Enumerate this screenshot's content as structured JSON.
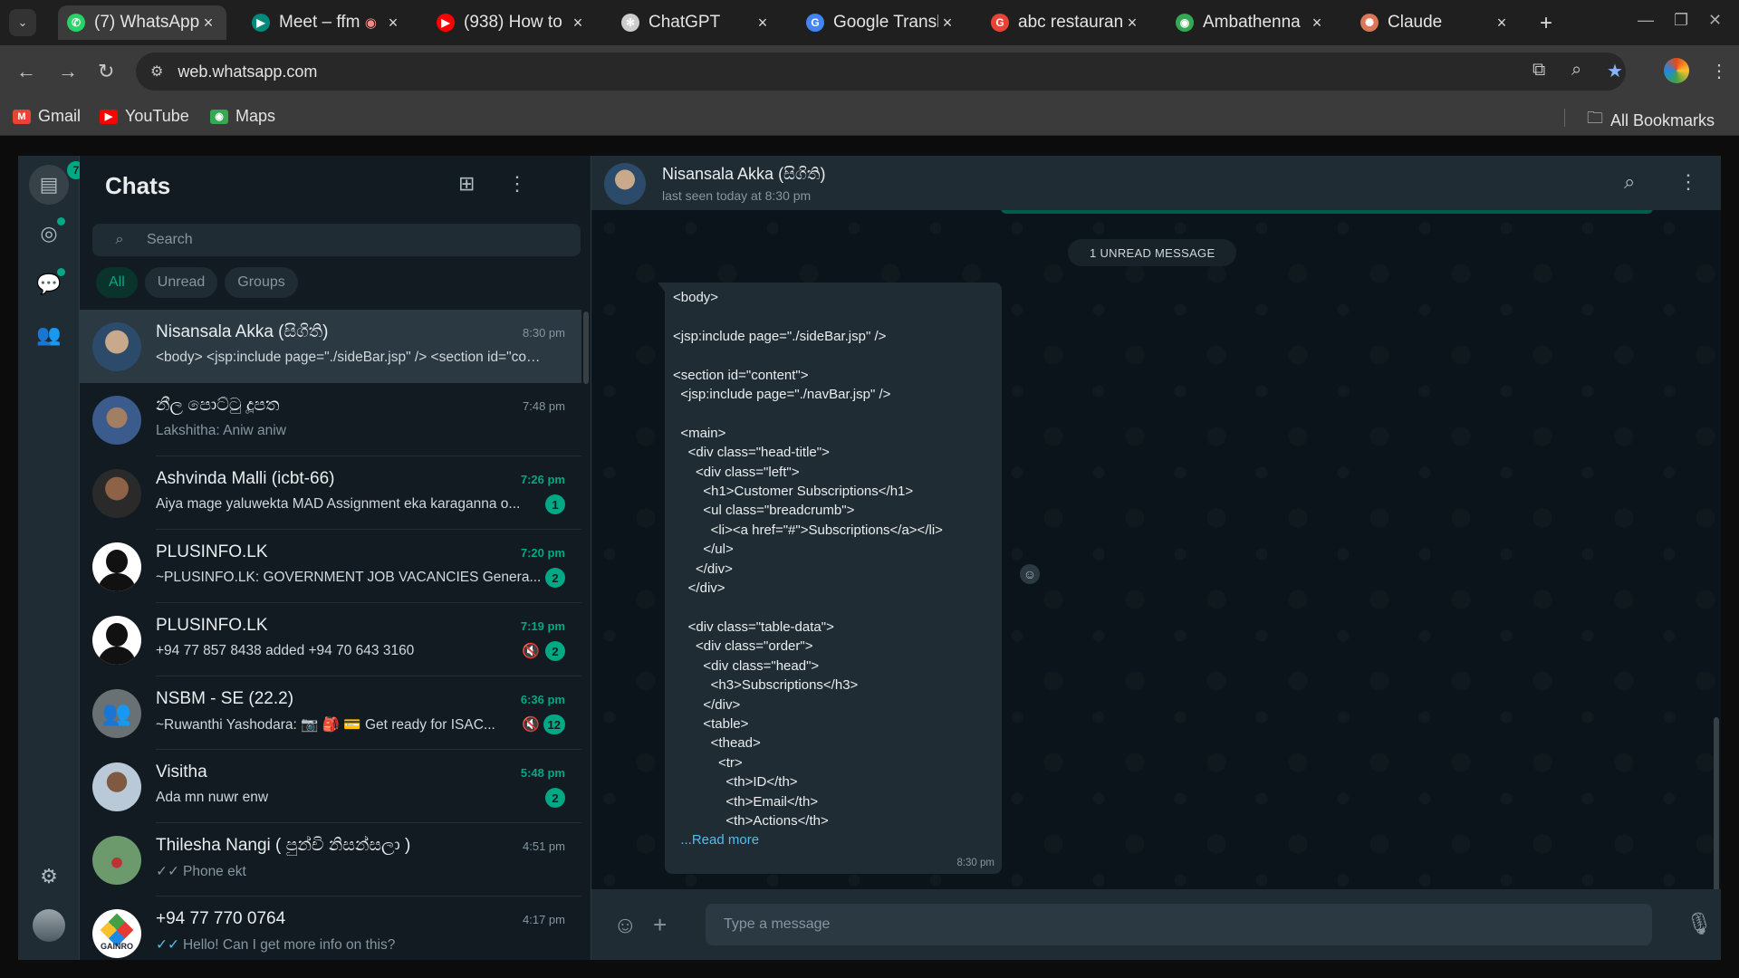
{
  "browser": {
    "tabs": [
      {
        "title": "(7) WhatsApp",
        "color": "#25d366",
        "glyph": "✆",
        "active": true
      },
      {
        "title": "Meet – ffm",
        "color": "#00897b",
        "glyph": "▶",
        "active": false,
        "recording": true
      },
      {
        "title": "(938) How to",
        "color": "#ff0000",
        "glyph": "▶",
        "active": false
      },
      {
        "title": "ChatGPT",
        "color": "#cccccc",
        "glyph": "✻",
        "active": false
      },
      {
        "title": "Google Transl",
        "color": "#4285f4",
        "glyph": "G",
        "active": false
      },
      {
        "title": "abc restauran",
        "color": "#ea4335",
        "glyph": "G",
        "active": false
      },
      {
        "title": "Ambathenna",
        "color": "#34a853",
        "glyph": "◉",
        "active": false
      },
      {
        "title": "Claude",
        "color": "#d97757",
        "glyph": "✺",
        "active": false
      }
    ],
    "url": "web.whatsapp.com",
    "bookmarks": [
      {
        "label": "Gmail",
        "color": "#ea4335",
        "glyph": "M"
      },
      {
        "label": "YouTube",
        "color": "#ff0000",
        "glyph": "▶"
      },
      {
        "label": "Maps",
        "color": "#34a853",
        "glyph": "◉"
      }
    ],
    "all_bookmarks": "All Bookmarks"
  },
  "rail": {
    "chats_badge": "7"
  },
  "sidebar": {
    "title": "Chats",
    "search_placeholder": "Search",
    "filters": [
      "All",
      "Unread",
      "Groups"
    ]
  },
  "chats": [
    {
      "name": "Nisansala Akka (සිගිති)",
      "time": "8:30 pm",
      "preview": "<body> <jsp:include page=\"./sideBar.jsp\" /> <section id=\"con...",
      "preview_color": "light",
      "unread": false,
      "badge": "",
      "muted": false,
      "tick": "",
      "avatar": "av-photo1",
      "selected": true
    },
    {
      "name": "නීල පොට්ටු දූපත",
      "time": "7:48 pm",
      "preview": "Lakshitha: Aniw aniw",
      "preview_color": "gray",
      "unread": false,
      "badge": "",
      "muted": false,
      "tick": "",
      "avatar": "av-photo2",
      "selected": false
    },
    {
      "name": "Ashvinda Malli (icbt-66)",
      "time": "7:26 pm",
      "preview": "Aiya mage yaluwekta MAD Assignment eka karaganna o...",
      "preview_color": "light",
      "unread": true,
      "badge": "1",
      "muted": false,
      "tick": "",
      "avatar": "av-photo3",
      "selected": false
    },
    {
      "name": "PLUSINFO.LK",
      "time": "7:20 pm",
      "preview": "~PLUSINFO.LK: GOVERNMENT JOB VACANCIES Genera...",
      "preview_color": "light",
      "unread": true,
      "badge": "2",
      "muted": false,
      "tick": "",
      "avatar": "av-silhouette",
      "selected": false
    },
    {
      "name": "PLUSINFO.LK",
      "time": "7:19 pm",
      "preview": "+94 77 857 8438 added +94 70 643 3160",
      "preview_color": "light",
      "unread": true,
      "badge": "2",
      "muted": true,
      "tick": "",
      "avatar": "av-silhouette",
      "selected": false
    },
    {
      "name": "NSBM - SE (22.2)",
      "time": "6:36 pm",
      "preview": "~Ruwanthi Yashodara: 📷 🎒 💳 Get ready for ISAC...",
      "preview_color": "light",
      "unread": true,
      "badge": "12",
      "muted": true,
      "tick": "",
      "avatar": "av-group",
      "selected": false
    },
    {
      "name": "Visitha",
      "time": "5:48 pm",
      "preview": "Ada mn nuwr enw",
      "preview_color": "light",
      "unread": true,
      "badge": "2",
      "muted": false,
      "tick": "",
      "avatar": "av-photo4",
      "selected": false
    },
    {
      "name": "Thilesha Nangi ( පුන්චි නිසන්සලා )",
      "time": "4:51 pm",
      "preview": "Phone ekt",
      "preview_color": "gray",
      "unread": false,
      "badge": "",
      "muted": false,
      "tick": "gray",
      "avatar": "av-photo5",
      "selected": false
    },
    {
      "name": "+94 77 770 0764",
      "time": "4:17 pm",
      "preview": "Hello! Can I get more info on this?",
      "preview_color": "gray",
      "unread": false,
      "badge": "",
      "muted": false,
      "tick": "blue",
      "avatar": "av-logo",
      "avatar_text": "GAINRO",
      "selected": false
    }
  ],
  "conversation": {
    "name": "Nisansala Akka (සිගිති)",
    "status": "last seen today at 8:30 pm",
    "unread_label": "1 UNREAD MESSAGE",
    "message_lines": [
      "<body>",
      "",
      "<jsp:include page=\"./sideBar.jsp\" />",
      "",
      "<section id=\"content\">",
      "  <jsp:include page=\"./navBar.jsp\" />",
      "",
      "  <main>",
      "    <div class=\"head-title\">",
      "      <div class=\"left\">",
      "        <h1>Customer Subscriptions</h1>",
      "        <ul class=\"breadcrumb\">",
      "          <li><a href=\"#\">Subscriptions</a></li>",
      "        </ul>",
      "      </div>",
      "    </div>",
      "",
      "    <div class=\"table-data\">",
      "      <div class=\"order\">",
      "        <div class=\"head\">",
      "          <h3>Subscriptions</h3>",
      "        </div>",
      "        <table>",
      "          <thead>",
      "            <tr>",
      "              <th>ID</th>",
      "              <th>Email</th>",
      "              <th>Actions</th>"
    ],
    "read_more_prefix": "  ...",
    "read_more": "Read more",
    "message_time": "8:30 pm",
    "input_placeholder": "Type a message"
  }
}
